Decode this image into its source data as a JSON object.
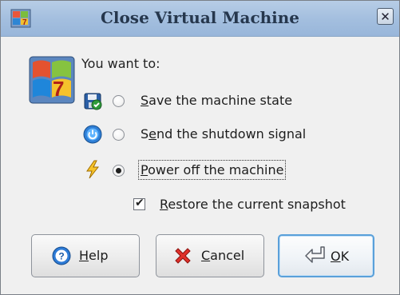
{
  "window": {
    "title": "Close Virtual Machine",
    "close_glyph": "✕"
  },
  "prompt": "You want to:",
  "options": [
    {
      "label_u": "S",
      "label_rest": "ave the machine state",
      "icon": "save-state-icon",
      "checked": false
    },
    {
      "label_u": "e",
      "label_prefix": "S",
      "label_rest": "nd the shutdown signal",
      "icon": "power-button-icon",
      "checked": false
    },
    {
      "label_u": "P",
      "label_rest": "ower off the machine",
      "icon": "lightning-icon",
      "checked": true
    }
  ],
  "restore_snapshot": {
    "label_u": "R",
    "label_rest": "estore the current snapshot",
    "checked": true
  },
  "buttons": {
    "help": {
      "label_u": "H",
      "label_rest": "elp"
    },
    "cancel": {
      "label_u": "C",
      "label_rest": "ancel"
    },
    "ok": {
      "label_u": "O",
      "label_rest": "K"
    }
  },
  "colors": {
    "titlebar": "#a4bfdf",
    "default_border": "#5aa0da"
  }
}
